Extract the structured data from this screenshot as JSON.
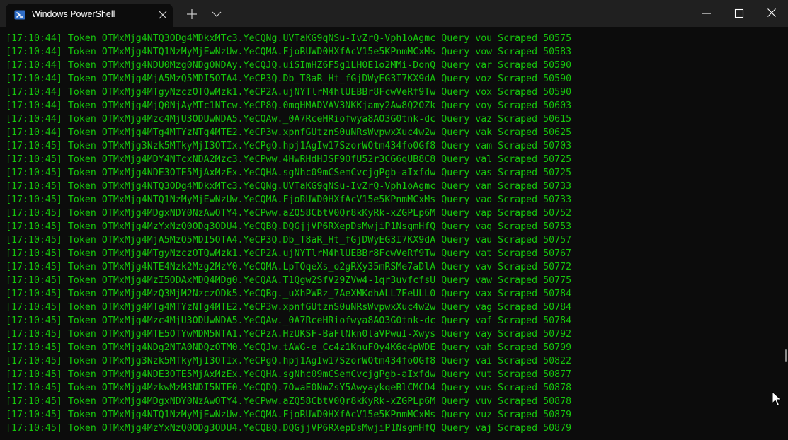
{
  "window": {
    "tab_title": "Windows PowerShell",
    "icons": {
      "tab": "powershell-icon",
      "close_tab": "close-icon",
      "new_tab": "plus-icon",
      "dropdown": "chevron-down-icon",
      "minimize": "minimize-icon",
      "maximize": "maximize-icon",
      "close_window": "close-icon"
    }
  },
  "colors": {
    "background": "#0c0c0c",
    "titlebar": "#202020",
    "text_green": "#16c60c",
    "powershell_blue": "#2f6dc6"
  },
  "log": [
    {
      "time": "[17:10:44]",
      "token": "OTMxMjg4NTQ3ODg4MDkxMTc3.YeCQNg.UVTaKG9qNSu-IvZrQ-Vph1oAgmc",
      "query": "vou",
      "scraped": "50575"
    },
    {
      "time": "[17:10:44]",
      "token": "OTMxMjg4NTQ1NzMyMjEwNzUw.YeCQMA.FjoRUWD0HXfAcV15e5KPnmMCxMs",
      "query": "vow",
      "scraped": "50583"
    },
    {
      "time": "[17:10:44]",
      "token": "OTMxMjg4NDU0Mzg0NDg0NDAy.YeCQJQ.uiSImHZ6F5g1LH0E1o2MMi-DonQ",
      "query": "var",
      "scraped": "50590"
    },
    {
      "time": "[17:10:44]",
      "token": "OTMxMjg4MjA5MzQ5MDI5OTA4.YeCP3Q.Db_T8aR_Ht_fGjDWyEG3I7KX9dA",
      "query": "voz",
      "scraped": "50590"
    },
    {
      "time": "[17:10:44]",
      "token": "OTMxMjg4MTgyNzczOTQwMzk1.YeCP2A.ujNYTlrM4hlUEBBr8FcwVeRf9Tw",
      "query": "vox",
      "scraped": "50590"
    },
    {
      "time": "[17:10:44]",
      "token": "OTMxMjg4MjQ0NjAyMTc1NTcw.YeCP8Q.0mqHMADVAV3NKKjamy2Aw8Q2OZk",
      "query": "voy",
      "scraped": "50603"
    },
    {
      "time": "[17:10:44]",
      "token": "OTMxMjg4Mzc4MjU3ODUwNDA5.YeCQAw._0A7RceHRiofwya8AO3G0tnk-dc",
      "query": "vaz",
      "scraped": "50615"
    },
    {
      "time": "[17:10:44]",
      "token": "OTMxMjg4MTg4MTYzNTg4MTE2.YeCP3w.xpnfGUtznS0uNRsWvpwxXuc4w2w",
      "query": "vak",
      "scraped": "50625"
    },
    {
      "time": "[17:10:45]",
      "token": "OTMxMjg3Nzk5MTkyMjI3OTIx.YeCPgQ.hpj1AgIw17SzorWQtm434fo0Gf8",
      "query": "vam",
      "scraped": "50703"
    },
    {
      "time": "[17:10:45]",
      "token": "OTMxMjg4MDY4NTcxNDA2Mzc3.YeCPww.4HwRHdHJSF9OfU52r3CG6qUB8C8",
      "query": "val",
      "scraped": "50725"
    },
    {
      "time": "[17:10:45]",
      "token": "OTMxMjg4NDE3OTE5MjAxMzEx.YeCQHA.sgNhc09mCSemCvcjgPgb-aIxfdw",
      "query": "vas",
      "scraped": "50725"
    },
    {
      "time": "[17:10:45]",
      "token": "OTMxMjg4NTQ3ODg4MDkxMTc3.YeCQNg.UVTaKG9qNSu-IvZrQ-Vph1oAgmc",
      "query": "van",
      "scraped": "50733"
    },
    {
      "time": "[17:10:45]",
      "token": "OTMxMjg4NTQ1NzMyMjEwNzUw.YeCQMA.FjoRUWD0HXfAcV15e5KPnmMCxMs",
      "query": "vao",
      "scraped": "50733"
    },
    {
      "time": "[17:10:45]",
      "token": "OTMxMjg4MDgxNDY0NzAwOTY4.YeCPww.aZQ58CbtV0Qr8kKyRk-xZGPLp6M",
      "query": "vap",
      "scraped": "50752"
    },
    {
      "time": "[17:10:45]",
      "token": "OTMxMjg4MzYxNzQ0ODg3ODU4.YeCQBQ.DQGjjVP6RXepDsMwjiP1NsgmHfQ",
      "query": "vaq",
      "scraped": "50753"
    },
    {
      "time": "[17:10:45]",
      "token": "OTMxMjg4MjA5MzQ5MDI5OTA4.YeCP3Q.Db_T8aR_Ht_fGjDWyEG3I7KX9dA",
      "query": "vau",
      "scraped": "50757"
    },
    {
      "time": "[17:10:45]",
      "token": "OTMxMjg4MTgyNzczOTQwMzk1.YeCP2A.ujNYTlrM4hlUEBBr8FcwVeRf9Tw",
      "query": "vat",
      "scraped": "50767"
    },
    {
      "time": "[17:10:45]",
      "token": "OTMxMjg4NTE4Nzk2Mzg2MzY0.YeCQMA.LpTQqeXs_o2gRXy35mRSMe7aDlA",
      "query": "vav",
      "scraped": "50772"
    },
    {
      "time": "[17:10:45]",
      "token": "OTMxMjg4MzI5ODAxMDQ4MDg0.YeCQAA.T1Qgw2SfV29ZVw4-1qr3uvfcfsU",
      "query": "vaw",
      "scraped": "50775"
    },
    {
      "time": "[17:10:45]",
      "token": "OTMxMjg4MzQ3MjM2NzczODk5.YeCQBg._uXhPWRz_7AeXMKdhALL7EeULL0",
      "query": "vax",
      "scraped": "50784"
    },
    {
      "time": "[17:10:45]",
      "token": "OTMxMjg4MTg4MTYzNTg4MTE2.YeCP3w.xpnfGUtznS0uNRsWvpwxXuc4w2w",
      "query": "vag",
      "scraped": "50784"
    },
    {
      "time": "[17:10:45]",
      "token": "OTMxMjg4Mzc4MjU3ODUwNDA5.YeCQAw._0A7RceHRiofwya8AO3G0tnk-dc",
      "query": "vaf",
      "scraped": "50784"
    },
    {
      "time": "[17:10:45]",
      "token": "OTMxMjg4MTE5OTYwMDM5NTA1.YeCPzA.HzUKSF-BaFlNkn0laVPwuI-Xwys",
      "query": "vay",
      "scraped": "50792"
    },
    {
      "time": "[17:10:45]",
      "token": "OTMxMjg4NDg2NTA0NDQzOTM0.YeCQJw.tAWG-e_Cc4z1KnuFOy4K6q4pWDE",
      "query": "vah",
      "scraped": "50799"
    },
    {
      "time": "[17:10:45]",
      "token": "OTMxMjg3Nzk5MTkyMjI3OTIx.YeCPgQ.hpj1AgIw17SzorWQtm434fo0Gf8",
      "query": "vai",
      "scraped": "50822"
    },
    {
      "time": "[17:10:45]",
      "token": "OTMxMjg4NDE3OTE5MjAxMzEx.YeCQHA.sgNhc09mCSemCvcjgPgb-aIxfdw",
      "query": "vut",
      "scraped": "50877"
    },
    {
      "time": "[17:10:45]",
      "token": "OTMxMjg4MzkwMzM3NDI5NTE0.YeCQDQ.7OwaE0NmZsY5AwyaykqeBlCMCD4",
      "query": "vus",
      "scraped": "50878"
    },
    {
      "time": "[17:10:45]",
      "token": "OTMxMjg4MDgxNDY0NzAwOTY4.YeCPww.aZQ58CbtV0Qr8kKyRk-xZGPLp6M",
      "query": "vuv",
      "scraped": "50878"
    },
    {
      "time": "[17:10:45]",
      "token": "OTMxMjg4NTQ1NzMyMjEwNzUw.YeCQMA.FjoRUWD0HXfAcV15e5KPnmMCxMs",
      "query": "vuz",
      "scraped": "50879"
    },
    {
      "time": "[17:10:45]",
      "token": "OTMxMjg4MzYxNzQ0ODg3ODU4.YeCQBQ.DQGjjVP6RXepDsMwjiP1NsgmHfQ",
      "query": "vaj",
      "scraped": "50879"
    }
  ],
  "labels": {
    "token": "Token",
    "query": "Query",
    "scraped": "Scraped"
  }
}
